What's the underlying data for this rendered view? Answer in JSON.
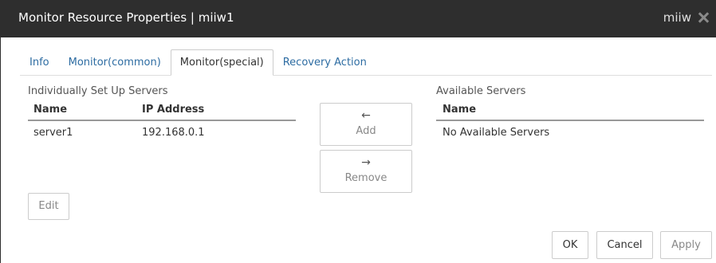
{
  "window": {
    "title": "Monitor Resource Properties | miiw1",
    "right_label": "miiw",
    "close_icon": "close-icon"
  },
  "tabs": [
    {
      "label": "Info",
      "active": false
    },
    {
      "label": "Monitor(common)",
      "active": false
    },
    {
      "label": "Monitor(special)",
      "active": true
    },
    {
      "label": "Recovery Action",
      "active": false
    }
  ],
  "individual": {
    "title": "Individually Set Up Servers",
    "columns": [
      "Name",
      "IP Address"
    ],
    "rows": [
      {
        "name": "server1",
        "ip": "192.168.0.1"
      }
    ]
  },
  "available": {
    "title": "Available Servers",
    "columns": [
      "Name"
    ],
    "rows": [
      {
        "name": "No Available Servers"
      }
    ]
  },
  "actions": {
    "add": {
      "label": "Add",
      "icon": "arrow-left-icon",
      "glyph": "←"
    },
    "remove": {
      "label": "Remove",
      "icon": "arrow-right-icon",
      "glyph": "→"
    },
    "edit": "Edit"
  },
  "footer": {
    "ok": "OK",
    "cancel": "Cancel",
    "apply": "Apply"
  },
  "colors": {
    "titlebar": "#2e2e2e",
    "tab_link": "#2d6ca2",
    "disabled_text": "#888888"
  }
}
